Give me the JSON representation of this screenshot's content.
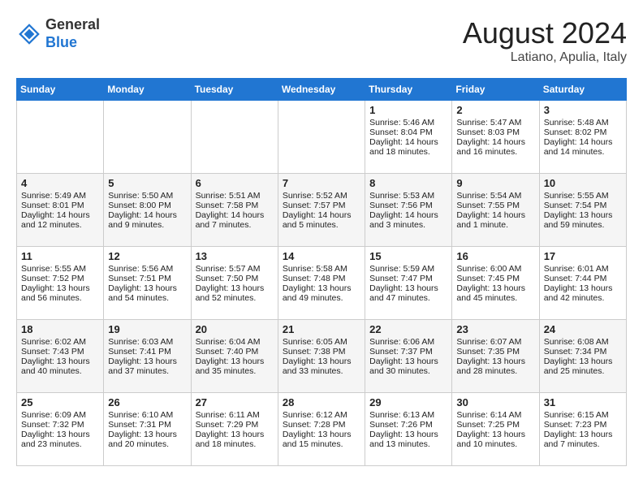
{
  "header": {
    "logo_line1": "General",
    "logo_line2": "Blue",
    "month_title": "August 2024",
    "subtitle": "Latiano, Apulia, Italy"
  },
  "days_of_week": [
    "Sunday",
    "Monday",
    "Tuesday",
    "Wednesday",
    "Thursday",
    "Friday",
    "Saturday"
  ],
  "weeks": [
    [
      {
        "day": "",
        "info": ""
      },
      {
        "day": "",
        "info": ""
      },
      {
        "day": "",
        "info": ""
      },
      {
        "day": "",
        "info": ""
      },
      {
        "day": "1",
        "info": "Sunrise: 5:46 AM\nSunset: 8:04 PM\nDaylight: 14 hours and 18 minutes."
      },
      {
        "day": "2",
        "info": "Sunrise: 5:47 AM\nSunset: 8:03 PM\nDaylight: 14 hours and 16 minutes."
      },
      {
        "day": "3",
        "info": "Sunrise: 5:48 AM\nSunset: 8:02 PM\nDaylight: 14 hours and 14 minutes."
      }
    ],
    [
      {
        "day": "4",
        "info": "Sunrise: 5:49 AM\nSunset: 8:01 PM\nDaylight: 14 hours and 12 minutes."
      },
      {
        "day": "5",
        "info": "Sunrise: 5:50 AM\nSunset: 8:00 PM\nDaylight: 14 hours and 9 minutes."
      },
      {
        "day": "6",
        "info": "Sunrise: 5:51 AM\nSunset: 7:58 PM\nDaylight: 14 hours and 7 minutes."
      },
      {
        "day": "7",
        "info": "Sunrise: 5:52 AM\nSunset: 7:57 PM\nDaylight: 14 hours and 5 minutes."
      },
      {
        "day": "8",
        "info": "Sunrise: 5:53 AM\nSunset: 7:56 PM\nDaylight: 14 hours and 3 minutes."
      },
      {
        "day": "9",
        "info": "Sunrise: 5:54 AM\nSunset: 7:55 PM\nDaylight: 14 hours and 1 minute."
      },
      {
        "day": "10",
        "info": "Sunrise: 5:55 AM\nSunset: 7:54 PM\nDaylight: 13 hours and 59 minutes."
      }
    ],
    [
      {
        "day": "11",
        "info": "Sunrise: 5:55 AM\nSunset: 7:52 PM\nDaylight: 13 hours and 56 minutes."
      },
      {
        "day": "12",
        "info": "Sunrise: 5:56 AM\nSunset: 7:51 PM\nDaylight: 13 hours and 54 minutes."
      },
      {
        "day": "13",
        "info": "Sunrise: 5:57 AM\nSunset: 7:50 PM\nDaylight: 13 hours and 52 minutes."
      },
      {
        "day": "14",
        "info": "Sunrise: 5:58 AM\nSunset: 7:48 PM\nDaylight: 13 hours and 49 minutes."
      },
      {
        "day": "15",
        "info": "Sunrise: 5:59 AM\nSunset: 7:47 PM\nDaylight: 13 hours and 47 minutes."
      },
      {
        "day": "16",
        "info": "Sunrise: 6:00 AM\nSunset: 7:45 PM\nDaylight: 13 hours and 45 minutes."
      },
      {
        "day": "17",
        "info": "Sunrise: 6:01 AM\nSunset: 7:44 PM\nDaylight: 13 hours and 42 minutes."
      }
    ],
    [
      {
        "day": "18",
        "info": "Sunrise: 6:02 AM\nSunset: 7:43 PM\nDaylight: 13 hours and 40 minutes."
      },
      {
        "day": "19",
        "info": "Sunrise: 6:03 AM\nSunset: 7:41 PM\nDaylight: 13 hours and 37 minutes."
      },
      {
        "day": "20",
        "info": "Sunrise: 6:04 AM\nSunset: 7:40 PM\nDaylight: 13 hours and 35 minutes."
      },
      {
        "day": "21",
        "info": "Sunrise: 6:05 AM\nSunset: 7:38 PM\nDaylight: 13 hours and 33 minutes."
      },
      {
        "day": "22",
        "info": "Sunrise: 6:06 AM\nSunset: 7:37 PM\nDaylight: 13 hours and 30 minutes."
      },
      {
        "day": "23",
        "info": "Sunrise: 6:07 AM\nSunset: 7:35 PM\nDaylight: 13 hours and 28 minutes."
      },
      {
        "day": "24",
        "info": "Sunrise: 6:08 AM\nSunset: 7:34 PM\nDaylight: 13 hours and 25 minutes."
      }
    ],
    [
      {
        "day": "25",
        "info": "Sunrise: 6:09 AM\nSunset: 7:32 PM\nDaylight: 13 hours and 23 minutes."
      },
      {
        "day": "26",
        "info": "Sunrise: 6:10 AM\nSunset: 7:31 PM\nDaylight: 13 hours and 20 minutes."
      },
      {
        "day": "27",
        "info": "Sunrise: 6:11 AM\nSunset: 7:29 PM\nDaylight: 13 hours and 18 minutes."
      },
      {
        "day": "28",
        "info": "Sunrise: 6:12 AM\nSunset: 7:28 PM\nDaylight: 13 hours and 15 minutes."
      },
      {
        "day": "29",
        "info": "Sunrise: 6:13 AM\nSunset: 7:26 PM\nDaylight: 13 hours and 13 minutes."
      },
      {
        "day": "30",
        "info": "Sunrise: 6:14 AM\nSunset: 7:25 PM\nDaylight: 13 hours and 10 minutes."
      },
      {
        "day": "31",
        "info": "Sunrise: 6:15 AM\nSunset: 7:23 PM\nDaylight: 13 hours and 7 minutes."
      }
    ]
  ]
}
